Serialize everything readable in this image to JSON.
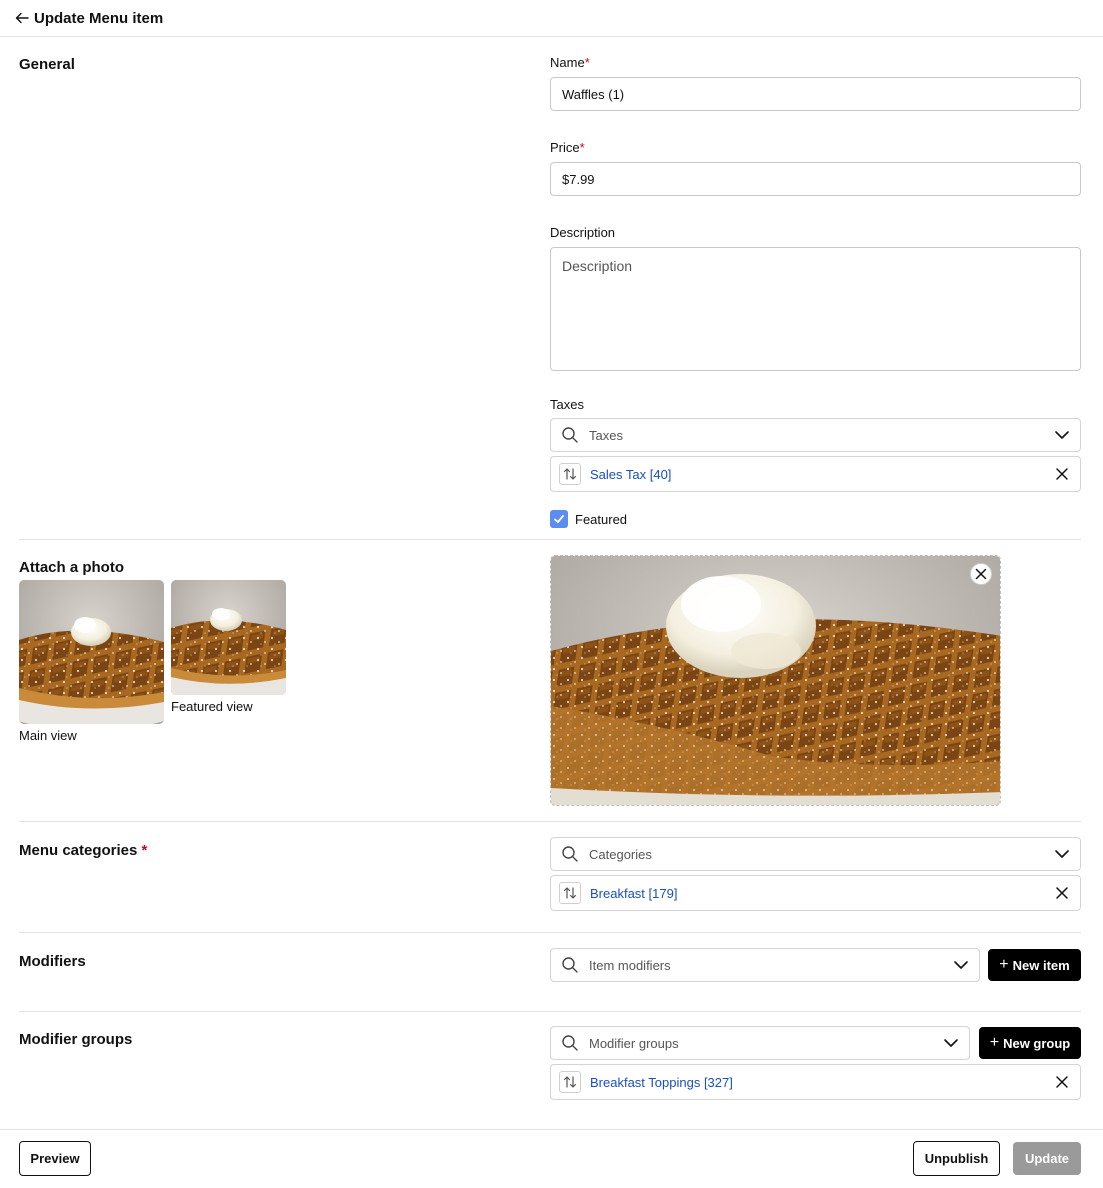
{
  "header": {
    "back_icon": "arrow-left-icon",
    "title": "Update Menu item"
  },
  "general": {
    "section_title": "General",
    "name": {
      "label": "Name",
      "required_mark": "*",
      "value": "Waffles (1)"
    },
    "price": {
      "label": "Price",
      "required_mark": "*",
      "value": "$7.99"
    },
    "description": {
      "label": "Description",
      "placeholder": "Description",
      "value": ""
    },
    "taxes": {
      "label": "Taxes",
      "placeholder": "Taxes",
      "selected": [
        {
          "label": "Sales Tax [40]"
        }
      ]
    },
    "featured": {
      "label": "Featured",
      "checked": true
    }
  },
  "photo": {
    "section_title": "Attach a photo",
    "main_caption": "Main view",
    "featured_caption": "Featured view"
  },
  "categories": {
    "section_title": "Menu categories",
    "required_mark": "*",
    "placeholder": "Categories",
    "selected": [
      {
        "label": "Breakfast [179]"
      }
    ]
  },
  "modifiers": {
    "section_title": "Modifiers",
    "placeholder": "Item modifiers",
    "new_button": "New item"
  },
  "modifier_groups": {
    "section_title": "Modifier groups",
    "placeholder": "Modifier groups",
    "new_button": "New group",
    "selected": [
      {
        "label": "Breakfast Toppings [327]"
      }
    ]
  },
  "footer": {
    "preview_button": "Preview",
    "unpublish_button": "Unpublish",
    "update_button": "Update"
  },
  "colors": {
    "accent": "#5b8def",
    "link": "#1a4fbf",
    "required": "#d0021b",
    "primary_button": "#000000",
    "disabled_button": "#9a9a9a"
  }
}
